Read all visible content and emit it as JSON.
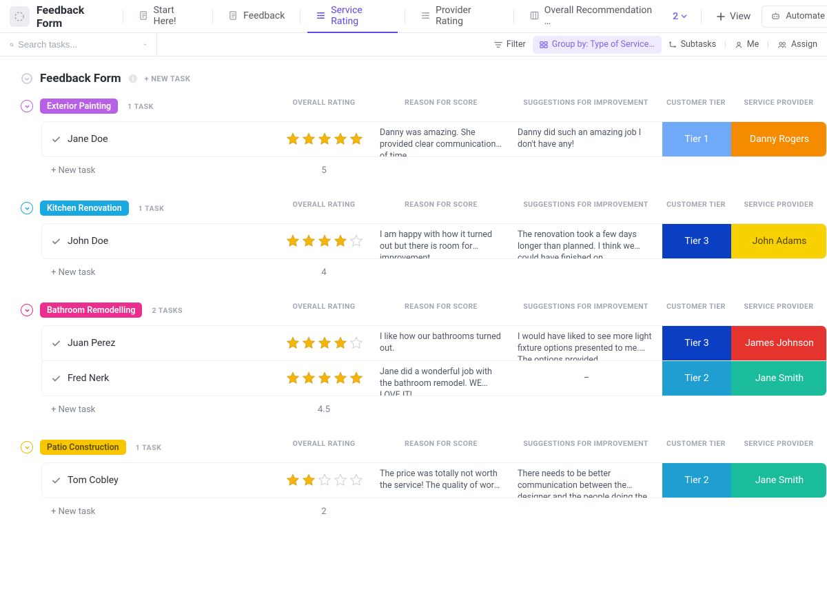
{
  "header": {
    "title": "Feedback Form",
    "tabs": [
      {
        "label": "Start Here!"
      },
      {
        "label": "Feedback"
      },
      {
        "label": "Service Rating"
      },
      {
        "label": "Provider Rating"
      },
      {
        "label": "Overall Recommendation …"
      }
    ],
    "more_count": "2",
    "view_label": "View",
    "automate_label": "Automate"
  },
  "toolbar": {
    "search_placeholder": "Search tasks...",
    "filter": "Filter",
    "group_by": "Group by: Type of Service…",
    "subtasks": "Subtasks",
    "me": "Me",
    "assign": "Assign"
  },
  "list": {
    "title": "Feedback Form",
    "new_task_label": "+ NEW TASK",
    "row_new_task": "+ New task",
    "columns": {
      "rating": "OVERALL RATING",
      "reason": "REASON FOR SCORE",
      "suggest": "SUGGESTIONS FOR IMPROVEMENT",
      "tier": "CUSTOMER TIER",
      "provider": "SERVICE PROVIDER"
    }
  },
  "groups": [
    {
      "name": "Exterior Painting",
      "color": "purple",
      "count_label": "1 TASK",
      "avg": "5",
      "rows": [
        {
          "name": "Jane Doe",
          "stars": 5,
          "reason": "Danny was amazing. She provided clear communication of time…",
          "suggest": "Danny did such an amazing job I don't have any!",
          "tier": {
            "label": "Tier 1",
            "class": "bg-tier1"
          },
          "provider": {
            "label": "Danny Rogers",
            "class": "prov-orange"
          }
        }
      ]
    },
    {
      "name": "Kitchen Renovation",
      "color": "cyan",
      "count_label": "1 TASK",
      "avg": "4",
      "rows": [
        {
          "name": "John Doe",
          "stars": 4,
          "reason": "I am happy with how it turned out but there is room for improvement",
          "suggest": "The renovation took a few days longer than planned. I think we could have finished on …",
          "tier": {
            "label": "Tier 3",
            "class": "bg-tier3"
          },
          "provider": {
            "label": "John Adams",
            "class": "prov-yellow"
          }
        }
      ]
    },
    {
      "name": "Bathroom Remodelling",
      "color": "pink",
      "count_label": "2 TASKS",
      "avg": "4.5",
      "rows": [
        {
          "name": "Juan Perez",
          "stars": 4,
          "reason": "I like how our bathrooms turned out.",
          "suggest": "I would have liked to see more light fixture options presented to me. The options provided…",
          "tier": {
            "label": "Tier 3",
            "class": "bg-tier3"
          },
          "provider": {
            "label": "James Johnson",
            "class": "prov-red"
          }
        },
        {
          "name": "Fred Nerk",
          "stars": 5,
          "reason": "Jane did a wonderful job with the bathroom remodel. WE LOVE IT!",
          "suggest": "–",
          "suggest_center": true,
          "tier": {
            "label": "Tier 2",
            "class": "bg-tier2"
          },
          "provider": {
            "label": "Jane Smith",
            "class": "prov-teal"
          }
        }
      ]
    },
    {
      "name": "Patio Construction",
      "color": "yellow",
      "count_label": "1 TASK",
      "avg": "2",
      "rows": [
        {
          "name": "Tom Cobley",
          "stars": 2,
          "reason": "The price was totally not worth the service! The quality of work …",
          "suggest": "There needs to be better communication between the designer and the people doing the…",
          "tier": {
            "label": "Tier 2",
            "class": "bg-tier2"
          },
          "provider": {
            "label": "Jane Smith",
            "class": "prov-teal"
          }
        }
      ]
    }
  ]
}
